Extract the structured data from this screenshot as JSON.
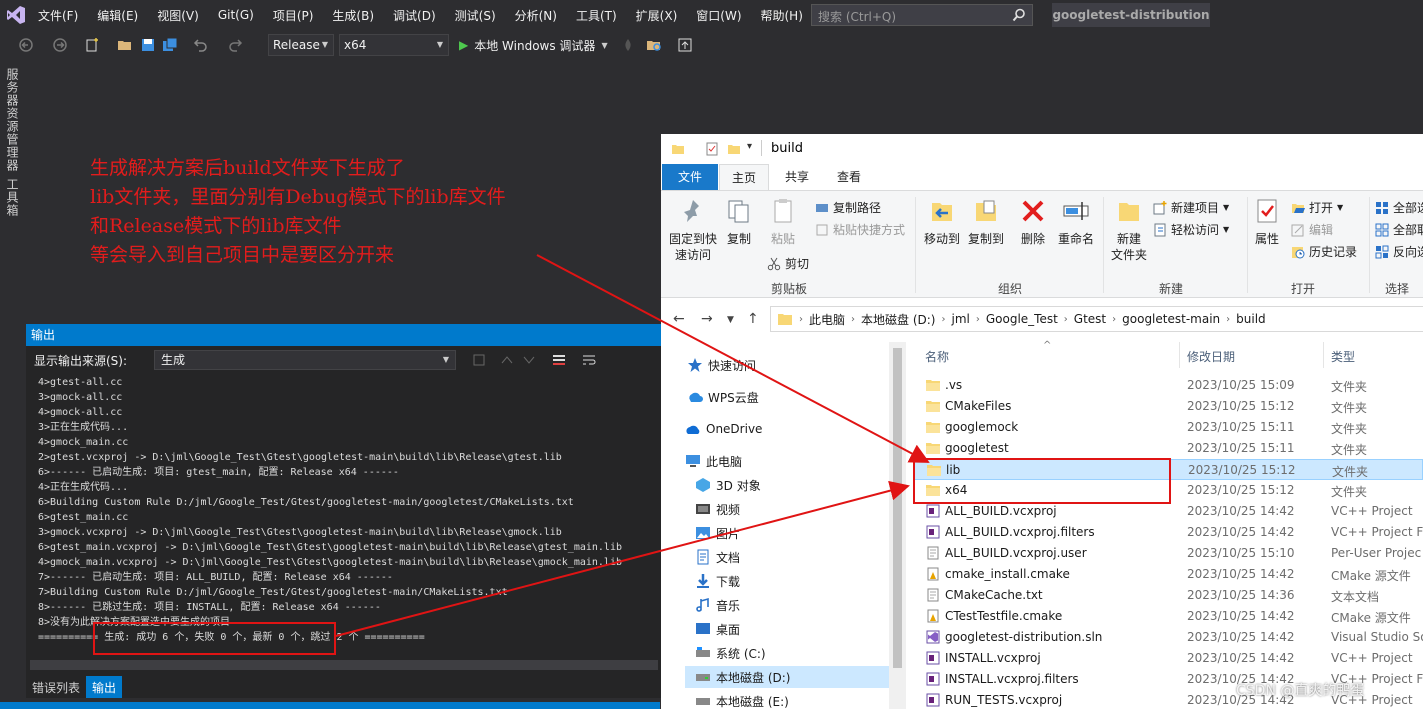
{
  "vs": {
    "menus": [
      "文件(F)",
      "编辑(E)",
      "视图(V)",
      "Git(G)",
      "项目(P)",
      "生成(B)",
      "调试(D)",
      "测试(S)",
      "分析(N)",
      "工具(T)",
      "扩展(X)",
      "窗口(W)",
      "帮助(H)"
    ],
    "search_placeholder": "搜索 (Ctrl+Q)",
    "solution_name": "googletest-distribution",
    "config": "Release",
    "platform": "x64",
    "run_label": "本地 Windows 调试器",
    "side_tabs": [
      "服务器资源管理器",
      "工具箱"
    ]
  },
  "annotation": {
    "lines": [
      "生成解决方案后build文件夹下生成了",
      "lib文件夹，里面分别有Debug模式下的lib库文件",
      "和Release模式下的lib库文件",
      "等会导入到自己项目中是要区分开来"
    ],
    "color": "#e21c1c"
  },
  "output": {
    "title": "输出",
    "source_label": "显示输出来源(S):",
    "source_value": "生成",
    "lines": [
      "4>gtest-all.cc",
      "3>gmock-all.cc",
      "4>gmock-all.cc",
      "3>正在生成代码...",
      "4>gmock_main.cc",
      "2>gtest.vcxproj -> D:\\jml\\Google_Test\\Gtest\\googletest-main\\build\\lib\\Release\\gtest.lib",
      "6>------ 已启动生成: 项目: gtest_main, 配置: Release x64 ------",
      "4>正在生成代码...",
      "6>Building Custom Rule D:/jml/Google_Test/Gtest/googletest-main/googletest/CMakeLists.txt",
      "6>gtest_main.cc",
      "3>gmock.vcxproj -> D:\\jml\\Google_Test\\Gtest\\googletest-main\\build\\lib\\Release\\gmock.lib",
      "6>gtest_main.vcxproj -> D:\\jml\\Google_Test\\Gtest\\googletest-main\\build\\lib\\Release\\gtest_main.lib",
      "4>gmock_main.vcxproj -> D:\\jml\\Google_Test\\Gtest\\googletest-main\\build\\lib\\Release\\gmock_main.lib",
      "7>------ 已启动生成: 项目: ALL_BUILD, 配置: Release x64 ------",
      "7>Building Custom Rule D:/jml/Google_Test/Gtest/googletest-main/CMakeLists.txt",
      "8>------ 已跳过生成: 项目: INSTALL, 配置: Release x64 ------",
      "8>没有为此解决方案配置选中要生成的项目",
      "========== 生成: 成功 6 个，失败 0 个，最新 0 个，跳过 2 个 =========="
    ],
    "tabs": [
      "错误列表",
      "输出"
    ],
    "active_tab": "输出"
  },
  "explorer": {
    "title": "build",
    "tabs": [
      "文件",
      "主页",
      "共享",
      "查看"
    ],
    "ribbon": {
      "clipboard": {
        "pin": "固定到快\n速访问",
        "copy": "复制",
        "paste": "粘贴",
        "copy_path": "复制路径",
        "paste_shortcut": "粘贴快捷方式",
        "cut": "剪切",
        "label": "剪贴板"
      },
      "organize": {
        "move_to": "移动到",
        "copy_to": "复制到",
        "delete": "删除",
        "rename": "重命名",
        "label": "组织"
      },
      "new": {
        "new_folder": "新建\n文件夹",
        "new_item": "新建项目",
        "easy_access": "轻松访问",
        "label": "新建"
      },
      "open": {
        "properties": "属性",
        "open": "打开",
        "edit": "编辑",
        "history": "历史记录",
        "label": "打开"
      },
      "select": {
        "select_all": "全部选",
        "select_none": "全部取",
        "invert": "反向选",
        "label": "选择"
      }
    },
    "breadcrumb": [
      "此电脑",
      "本地磁盘 (D:)",
      "jml",
      "Google_Test",
      "Gtest",
      "googletest-main",
      "build"
    ],
    "nav": [
      "快速访问",
      "WPS云盘",
      "OneDrive",
      "此电脑",
      "3D 对象",
      "视频",
      "图片",
      "文档",
      "下载",
      "音乐",
      "桌面",
      "系统 (C:)",
      "本地磁盘 (D:)",
      "本地磁盘 (E:)"
    ],
    "nav_selected": "本地磁盘 (D:)",
    "columns": [
      "名称",
      "修改日期",
      "类型"
    ],
    "files": [
      {
        "name": ".vs",
        "date": "2023/10/25 15:09",
        "type": "文件夹",
        "kind": "folder"
      },
      {
        "name": "CMakeFiles",
        "date": "2023/10/25 15:12",
        "type": "文件夹",
        "kind": "folder"
      },
      {
        "name": "googlemock",
        "date": "2023/10/25 15:11",
        "type": "文件夹",
        "kind": "folder"
      },
      {
        "name": "googletest",
        "date": "2023/10/25 15:11",
        "type": "文件夹",
        "kind": "folder"
      },
      {
        "name": "lib",
        "date": "2023/10/25 15:12",
        "type": "文件夹",
        "kind": "folder"
      },
      {
        "name": "x64",
        "date": "2023/10/25 15:12",
        "type": "文件夹",
        "kind": "folder"
      },
      {
        "name": "ALL_BUILD.vcxproj",
        "date": "2023/10/25 14:42",
        "type": "VC++ Project",
        "kind": "vcx"
      },
      {
        "name": "ALL_BUILD.vcxproj.filters",
        "date": "2023/10/25 14:42",
        "type": "VC++ Project Fi",
        "kind": "vcx"
      },
      {
        "name": "ALL_BUILD.vcxproj.user",
        "date": "2023/10/25 15:10",
        "type": "Per-User Projec",
        "kind": "doc"
      },
      {
        "name": "cmake_install.cmake",
        "date": "2023/10/25 14:42",
        "type": "CMake 源文件",
        "kind": "cmake"
      },
      {
        "name": "CMakeCache.txt",
        "date": "2023/10/25 14:36",
        "type": "文本文档",
        "kind": "doc"
      },
      {
        "name": "CTestTestfile.cmake",
        "date": "2023/10/25 14:42",
        "type": "CMake 源文件",
        "kind": "cmake"
      },
      {
        "name": "googletest-distribution.sln",
        "date": "2023/10/25 14:42",
        "type": "Visual Studio So",
        "kind": "sln"
      },
      {
        "name": "INSTALL.vcxproj",
        "date": "2023/10/25 14:42",
        "type": "VC++ Project",
        "kind": "vcx"
      },
      {
        "name": "INSTALL.vcxproj.filters",
        "date": "2023/10/25 14:42",
        "type": "VC++ Project Fi",
        "kind": "vcx"
      },
      {
        "name": "RUN_TESTS.vcxproj",
        "date": "2023/10/25 14:42",
        "type": "VC++ Project",
        "kind": "vcx"
      }
    ],
    "selected_file": "lib"
  },
  "watermark": "CSDN @直爽的鸭蛋"
}
